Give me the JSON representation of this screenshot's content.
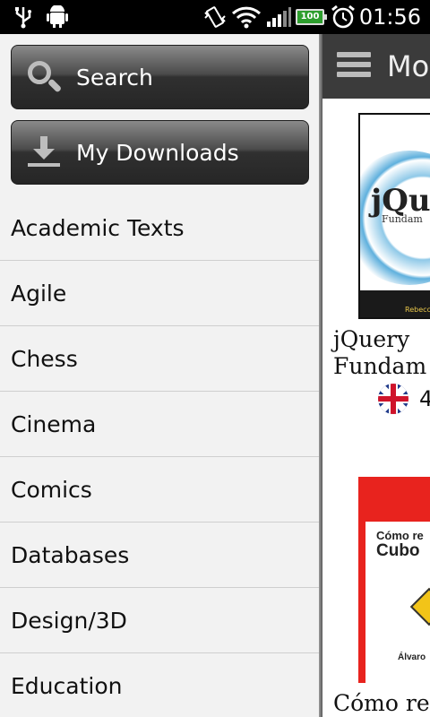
{
  "status_bar": {
    "time": "01:56",
    "battery": "100",
    "icons": [
      "usb-icon",
      "android-debug-icon",
      "vibrate-icon",
      "wifi-icon",
      "signal-icon",
      "battery-icon",
      "alarm-icon"
    ]
  },
  "drawer": {
    "search_label": "Search",
    "downloads_label": "My Downloads",
    "categories": [
      "Academic Texts",
      "Agile",
      "Chess",
      "Cinema",
      "Comics",
      "Databases",
      "Design/3D",
      "Education"
    ]
  },
  "main": {
    "title": "Mo",
    "books": [
      {
        "cover_title": "jQu",
        "cover_subtitle": "Fundam",
        "cover_footer": "Rebecc",
        "title_line1": "jQuery",
        "title_line2": "Fundam",
        "rating": "4"
      },
      {
        "cover_title": "Cómo re",
        "cover_subtitle": "Cubo",
        "cover_author": "Álvaro",
        "title_line1": "Cómo re"
      }
    ]
  },
  "colors": {
    "drawer_bg": "#f2f2f2",
    "action_bar": "#3b3b3b",
    "book2_cover": "#e8231e"
  }
}
